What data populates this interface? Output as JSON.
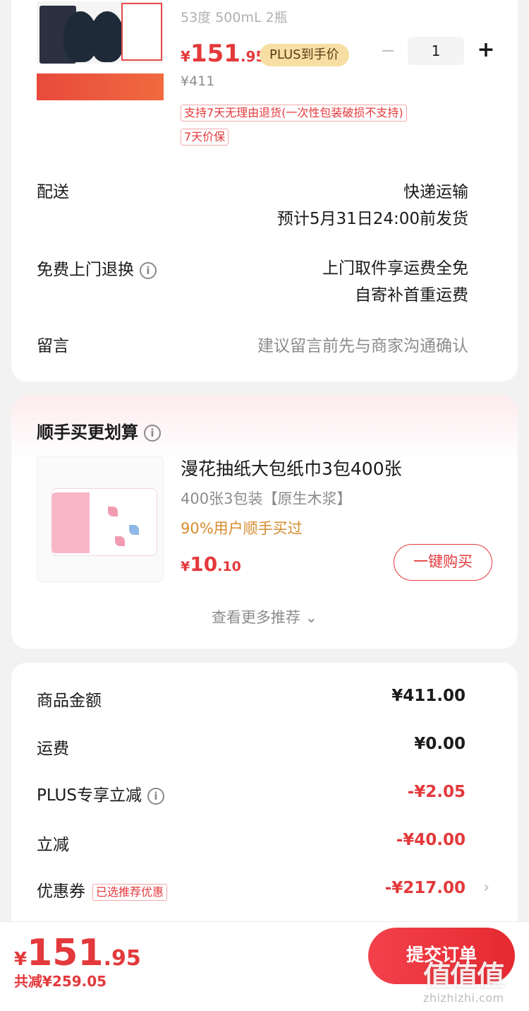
{
  "product": {
    "spec": "53度 500mL 2瓶",
    "price_yen": "¥",
    "price_int": "151",
    "price_dec": ".95",
    "plus_tag": "PLUS到手价",
    "old_price": "¥411",
    "quantity": "1",
    "minus": "−",
    "plus": "+",
    "return_tag": "支持7天无理由退货(一次性包装破损不支持)",
    "price_guard_tag": "7天价保"
  },
  "shipping": {
    "label": "配送",
    "method": "快递运输",
    "eta": "预计5月31日24:00前发货"
  },
  "return_service": {
    "label": "免费上门退换",
    "info_icon": "i",
    "line1": "上门取件享运费全免",
    "line2": "自寄补首重运费"
  },
  "message": {
    "label": "留言",
    "placeholder": "建议留言前先与商家沟通确认"
  },
  "recommend": {
    "title": "顺手买更划算",
    "info_icon": "i",
    "name": "漫花抽纸大包纸巾3包400张",
    "spec": "400张3包装【原生木浆】",
    "ratio": "90%用户顺手买过",
    "price_yen": "¥",
    "price_int": "10",
    "price_dec": ".10",
    "buy_label": "一键购买",
    "more_label": "查看更多推荐 ⌄"
  },
  "summary": {
    "goods_label": "商品金额",
    "goods_value": "¥411.00",
    "freight_label": "运费",
    "freight_value": "¥0.00",
    "plus_label": "PLUS专享立减",
    "plus_value": "-¥2.05",
    "discount_label": "立减",
    "discount_value": "-¥40.00",
    "coupon_label": "优惠券",
    "coupon_tag": "已选推荐优惠",
    "coupon_value": "-¥217.00",
    "chevron": "›"
  },
  "bottom": {
    "total_yen": "¥",
    "total_int": "151",
    "total_dec": ".95",
    "saved": "共减¥259.05",
    "submit": "提交订单",
    "watermark_logo": "值值值",
    "watermark_text": "zhizhizhi.com"
  },
  "colors": {
    "accent": "#e4393c",
    "plus_badge": "#f7dfa3",
    "ratio_text": "#d68b2c"
  }
}
